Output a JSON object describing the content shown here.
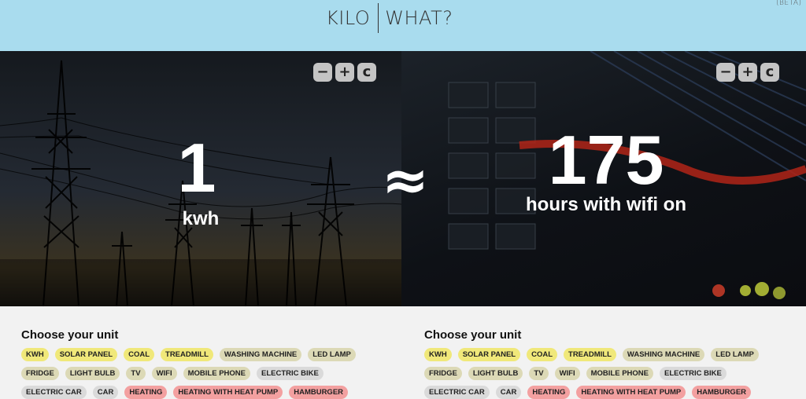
{
  "header": {
    "logo_left": "KILO",
    "logo_right": "WHAT?",
    "beta": "(BETA)"
  },
  "left": {
    "value": "1",
    "unit": "kwh",
    "controls": {
      "minus": "−",
      "plus": "+",
      "clear": "c"
    }
  },
  "approx_symbol": "≈",
  "right": {
    "value": "175",
    "unit": "hours with wifi on",
    "controls": {
      "minus": "−",
      "plus": "+",
      "clear": "c"
    }
  },
  "sections": {
    "left": {
      "title": "Choose your unit",
      "tags": [
        {
          "label": "KWH",
          "color": "yellow"
        },
        {
          "label": "SOLAR PANEL",
          "color": "yellow"
        },
        {
          "label": "COAL",
          "color": "yellow"
        },
        {
          "label": "TREADMILL",
          "color": "yellow"
        },
        {
          "label": "WASHING MACHINE",
          "color": "beige"
        },
        {
          "label": "LED LAMP",
          "color": "beige"
        },
        {
          "label": "FRIDGE",
          "color": "beige"
        },
        {
          "label": "LIGHT BULB",
          "color": "beige"
        },
        {
          "label": "TV",
          "color": "beige"
        },
        {
          "label": "WIFI",
          "color": "beige"
        },
        {
          "label": "MOBILE PHONE",
          "color": "beige"
        },
        {
          "label": "ELECTRIC BIKE",
          "color": "gray"
        },
        {
          "label": "ELECTRIC CAR",
          "color": "gray"
        },
        {
          "label": "CAR",
          "color": "gray"
        },
        {
          "label": "HEATING",
          "color": "red"
        },
        {
          "label": "HEATING WITH HEAT PUMP",
          "color": "red"
        },
        {
          "label": "HAMBURGER",
          "color": "red"
        }
      ]
    },
    "right": {
      "title": "Choose your unit",
      "tags": [
        {
          "label": "KWH",
          "color": "yellow"
        },
        {
          "label": "SOLAR PANEL",
          "color": "yellow"
        },
        {
          "label": "COAL",
          "color": "yellow"
        },
        {
          "label": "TREADMILL",
          "color": "yellow"
        },
        {
          "label": "WASHING MACHINE",
          "color": "beige"
        },
        {
          "label": "LED LAMP",
          "color": "beige"
        },
        {
          "label": "FRIDGE",
          "color": "beige"
        },
        {
          "label": "LIGHT BULB",
          "color": "beige"
        },
        {
          "label": "TV",
          "color": "beige"
        },
        {
          "label": "WIFI",
          "color": "beige"
        },
        {
          "label": "MOBILE PHONE",
          "color": "beige"
        },
        {
          "label": "ELECTRIC BIKE",
          "color": "gray"
        },
        {
          "label": "ELECTRIC CAR",
          "color": "gray"
        },
        {
          "label": "CAR",
          "color": "gray"
        },
        {
          "label": "HEATING",
          "color": "red"
        },
        {
          "label": "HEATING WITH HEAT PUMP",
          "color": "red"
        },
        {
          "label": "HAMBURGER",
          "color": "red"
        }
      ]
    }
  },
  "colors": {
    "header_bg": "#a9dcee",
    "tag_yellow": "#f0e87a",
    "tag_beige": "#dcd9b6",
    "tag_gray": "#dadada",
    "tag_red": "#f3a0a0"
  }
}
